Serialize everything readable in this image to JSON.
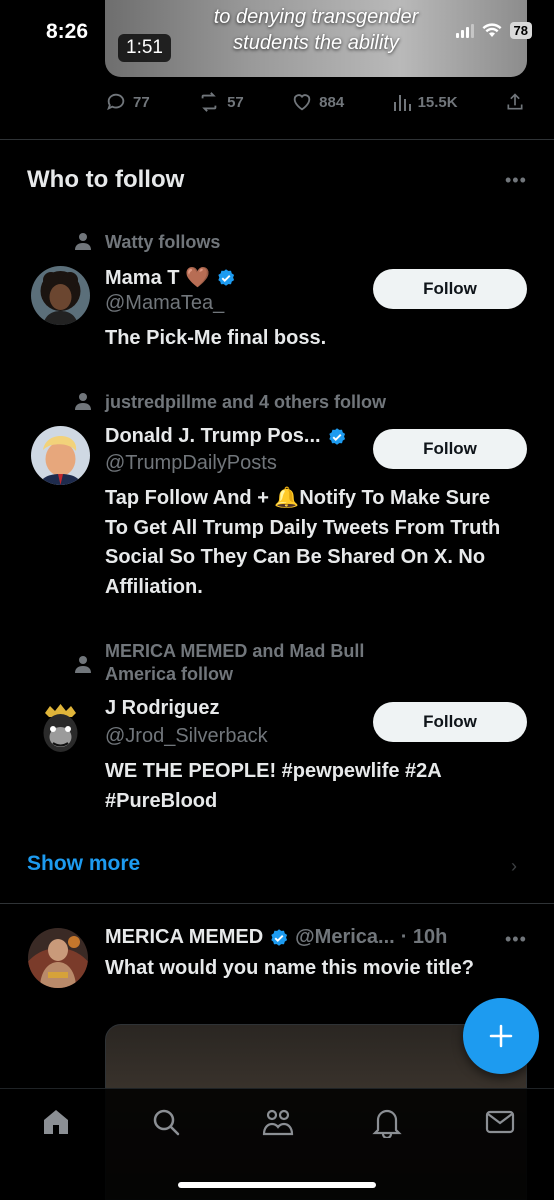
{
  "status_bar": {
    "time": "8:26",
    "battery": "78"
  },
  "top_video": {
    "caption_line1": "to denying transgender",
    "caption_line2": "students the ability",
    "duration": "1:51"
  },
  "top_tweet_actions": {
    "replies": "77",
    "retweets": "57",
    "likes": "884",
    "views": "15.5K"
  },
  "who_to_follow": {
    "title": "Who to follow",
    "suggestions": [
      {
        "context": "Watty follows",
        "name": "Mama T 🤎",
        "handle": "@MamaTea_",
        "bio": "The Pick-Me final boss.",
        "follow_label": "Follow",
        "verified": true
      },
      {
        "context": "justredpillme and 4 others follow",
        "name": "Donald J. Trump Pos...",
        "handle": "@TrumpDailyPosts",
        "bio": "Tap Follow And + 🔔Notify To Make Sure To Get All Trump Daily Tweets From Truth Social So They Can Be Shared On X. No Affiliation.",
        "follow_label": "Follow",
        "verified": true
      },
      {
        "context": "MERICA MEMED and Mad Bull America follow",
        "name": "J Rodriguez",
        "handle": "@Jrod_Silverback",
        "bio": "WE THE PEOPLE! #pewpewlife #2A #PureBlood",
        "follow_label": "Follow",
        "verified": false
      }
    ],
    "show_more": "Show more"
  },
  "tweet": {
    "name": "MERICA MEMED",
    "handle": "@Merica...",
    "time": "· 10h",
    "text": "What would you name this movie title?"
  },
  "colors": {
    "accent": "#1d9bf0",
    "background": "#000000",
    "secondary_text": "#71767b",
    "primary_text": "#e7e9ea"
  },
  "icons": [
    "home-icon",
    "search-icon",
    "communities-icon",
    "notifications-icon",
    "messages-icon",
    "compose-plus-icon"
  ]
}
